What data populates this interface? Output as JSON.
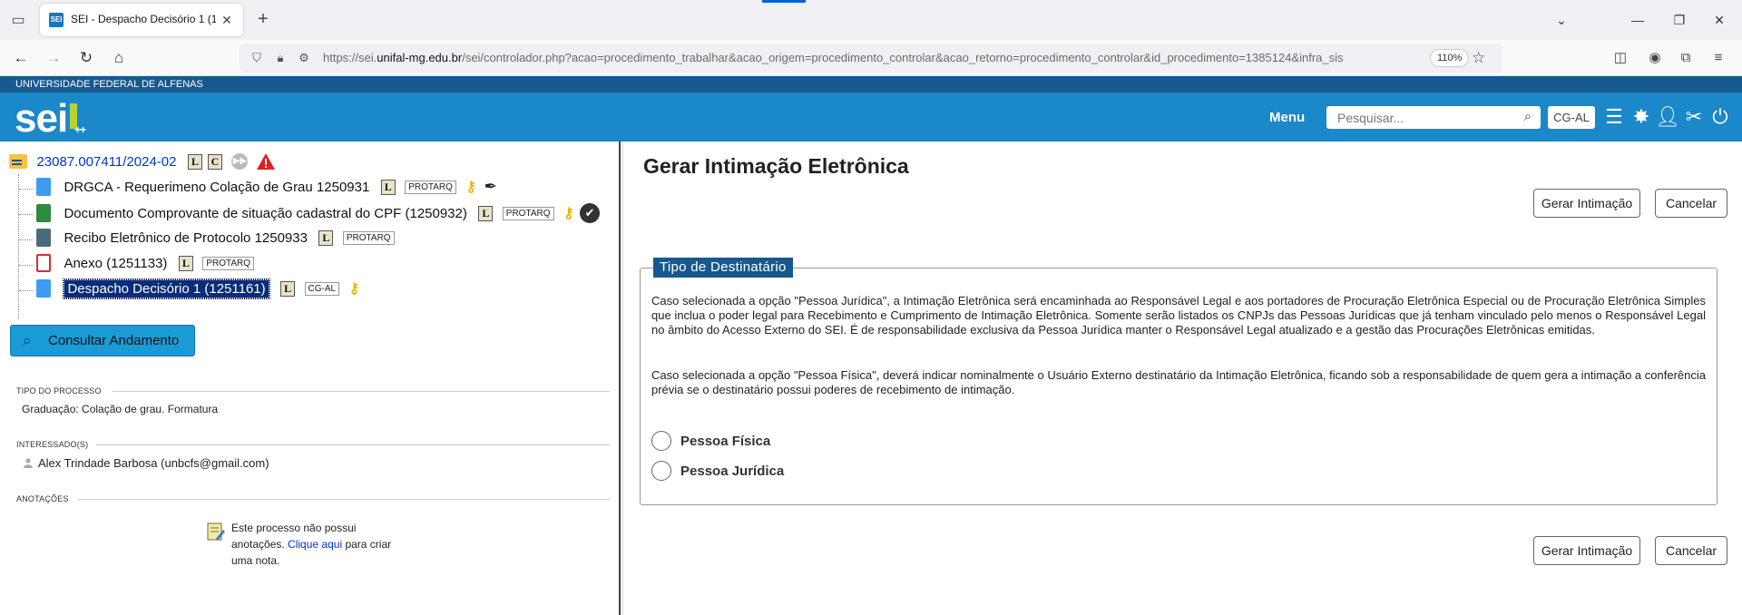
{
  "browser": {
    "tab_title": "SEI - Despacho Decisório 1 (125",
    "tab_favicon": "SEI",
    "url_prefix": "https://sei.",
    "url_domain": "unifal-mg.edu.br",
    "url_path": "/sei/controlador.php?acao=procedimento_trabalhar&acao_origem=procedimento_controlar&acao_retorno=procedimento_controlar&id_procedimento=1385124&infra_sis",
    "zoom": "110%"
  },
  "header": {
    "institution": "UNIVERSIDADE FEDERAL DE ALFENAS",
    "logo": "sei",
    "logo_suffix": "++",
    "menu_label": "Menu",
    "search_placeholder": "Pesquisar...",
    "unit": "CG-AL"
  },
  "tree": {
    "process_number": "23087.007411/2024-02",
    "badges": [
      "L",
      "C"
    ],
    "documents": [
      {
        "name": "DRGCA - Requerimeno Colação de Grau 1250931",
        "badge": "L",
        "tag": "PROTARQ",
        "icon": "document-blue-icon"
      },
      {
        "name": "Documento Comprovante de situação cadastral do CPF (1250932)",
        "badge": "L",
        "tag": "PROTARQ",
        "icon": "image-document-icon"
      },
      {
        "name": "Recibo Eletrônico de Protocolo 1250933",
        "badge": "L",
        "tag": "PROTARQ",
        "icon": "form-document-icon"
      },
      {
        "name": "Anexo (1251133)",
        "badge": "L",
        "tag": "PROTARQ",
        "icon": "pdf-document-icon"
      },
      {
        "name": "Despacho Decisório 1 (1251161)",
        "badge": "L",
        "tag": "CG-AL",
        "icon": "document-blue-icon"
      }
    ]
  },
  "left": {
    "consultar_label": "Consultar Andamento",
    "tipo_title": "Tipo do Processo",
    "tipo_value": "Graduação: Colação de grau. Formatura",
    "interessados_title": "Interessado(s)",
    "interessado_value": "Alex Trindade Barbosa (unbcfs@gmail.com)",
    "anotacoes_title": "Anotações",
    "note_line1": "Este processo não possui",
    "note_line2_pre": "anotações.",
    "note_line2_link": "Clique aqui",
    "note_line2_post": "para criar",
    "note_line3": "uma nota."
  },
  "form": {
    "title": "Gerar Intimação Eletrônica",
    "generate_button": "Gerar Intimação",
    "cancel_button": "Cancelar",
    "legend": "Tipo de Destinatário",
    "paragraph1": "Caso selecionada a opção \"Pessoa Jurídica\", a Intimação Eletrônica será encaminhada ao Responsável Legal e aos portadores de Procuração Eletrônica Especial ou de Procuração Eletrônica Simples que inclua o poder legal para Recebimento e Cumprimento de Intimação Eletrônica. Somente serão listados os CNPJs das Pessoas Jurídicas que já tenham vinculado pelo menos o Responsável Legal no âmbito do Acesso Externo do SEI. É de responsabilidade exclusiva da Pessoa Jurídica manter o Responsável Legal atualizado e a gestão das Procurações Eletrônicas emitidas.",
    "paragraph2": "Caso selecionada a opção \"Pessoa Física\", deverá indicar nominalmente o Usuário Externo destinatário da Intimação Eletrônica, ficando sob a responsabilidade de quem gera a intimação a conferência prévia se o destinatário possui poderes de recebimento de intimação.",
    "option_fisica": "Pessoa Física",
    "option_juridica": "Pessoa Jurídica"
  },
  "colors": {
    "header_blue": "#1b88c9",
    "header_dark": "#17588f",
    "link_blue": "#0033cc",
    "legend_bg": "#17588f"
  }
}
